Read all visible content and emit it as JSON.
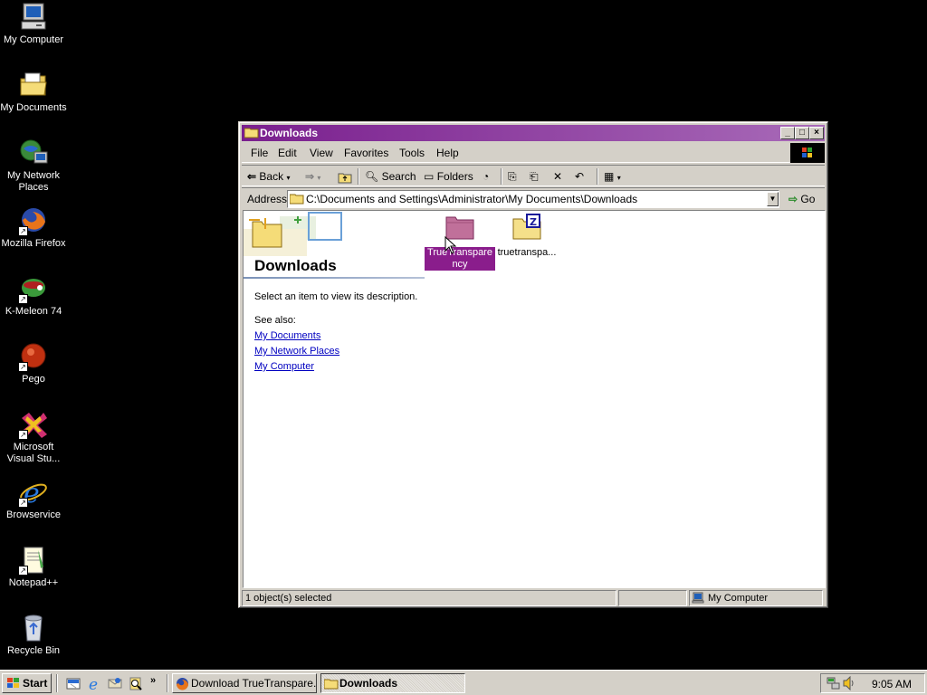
{
  "desktop": {
    "icons": [
      {
        "label": "My Computer",
        "icon": "my-computer-icon"
      },
      {
        "label": "My Documents",
        "icon": "my-documents-icon"
      },
      {
        "label": "My Network Places",
        "icon": "network-places-icon"
      },
      {
        "label": "Mozilla Firefox",
        "icon": "firefox-icon"
      },
      {
        "label": "K-Meleon 74",
        "icon": "k-meleon-icon"
      },
      {
        "label": "Pego",
        "icon": "pego-icon"
      },
      {
        "label": "Microsoft Visual Stu...",
        "icon": "visual-studio-icon"
      },
      {
        "label": "Browservice",
        "icon": "internet-explorer-icon"
      },
      {
        "label": "Notepad++",
        "icon": "notepad-plus-plus-icon"
      },
      {
        "label": "Recycle Bin",
        "icon": "recycle-bin-icon"
      }
    ]
  },
  "window": {
    "title": "Downloads",
    "title_gradient": [
      "#7a1f8e",
      "#a86ab8"
    ],
    "menu": [
      "File",
      "Edit",
      "View",
      "Favorites",
      "Tools",
      "Help"
    ],
    "toolbar": {
      "back": "Back",
      "search": "Search",
      "folders": "Folders"
    },
    "address": {
      "label": "Address",
      "value": "C:\\Documents and Settings\\Administrator\\My Documents\\Downloads",
      "go": "Go"
    },
    "panel": {
      "title": "Downloads",
      "description": "Select an item to view its description.",
      "see_also": "See also:",
      "links": [
        "My Documents",
        "My Network Places",
        "My Computer"
      ]
    },
    "files": [
      {
        "label": "TrueTransparency",
        "line1": "TrueTranspare",
        "line2": "ncy",
        "type": "folder",
        "selected": true,
        "color": "#c0709a"
      },
      {
        "label": "truetranspa...",
        "type": "zip-folder",
        "selected": false,
        "color": "#f5e08a"
      }
    ],
    "status": {
      "selection": "1 object(s) selected",
      "zone": "My Computer"
    }
  },
  "taskbar": {
    "start": "Start",
    "tasks": [
      {
        "label": "Download TrueTranspare...",
        "active": false,
        "icon": "firefox-icon"
      },
      {
        "label": "Downloads",
        "active": true,
        "icon": "folder-icon"
      }
    ],
    "clock": "9:05 AM"
  }
}
